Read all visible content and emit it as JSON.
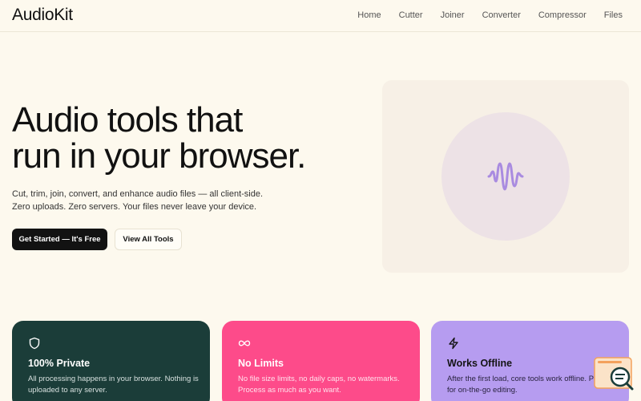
{
  "header": {
    "logo": "AudioKit",
    "nav": [
      "Home",
      "Cutter",
      "Joiner",
      "Converter",
      "Compressor",
      "Files"
    ]
  },
  "hero": {
    "title_line1": "Audio tools that",
    "title_line2": "run in your browser.",
    "sub_line1": "Cut, trim, join, convert, and enhance audio files — all client-side.",
    "sub_line2": "Zero uploads. Zero servers. Your files never leave your device.",
    "primary_button": "Get Started — It's Free",
    "secondary_button": "View All Tools"
  },
  "visual": {
    "icon": "audio-wave-icon",
    "accent": "#a98be0"
  },
  "features": [
    {
      "icon": "shield-icon",
      "title": "100% Private",
      "desc": "All processing happens in your browser. Nothing is uploaded to any server.",
      "bg": "#1b3d39"
    },
    {
      "icon": "infinity-icon",
      "title": "No Limits",
      "desc": "No file size limits, no daily caps, no watermarks. Process as much as you want.",
      "bg": "#fd4b8a"
    },
    {
      "icon": "lightning-icon",
      "title": "Works Offline",
      "desc": "After the first load, core tools work offline. Perfect for on-the-go editing.",
      "bg": "#b69cf0"
    }
  ],
  "widget": {
    "icon": "search-chat-icon"
  }
}
